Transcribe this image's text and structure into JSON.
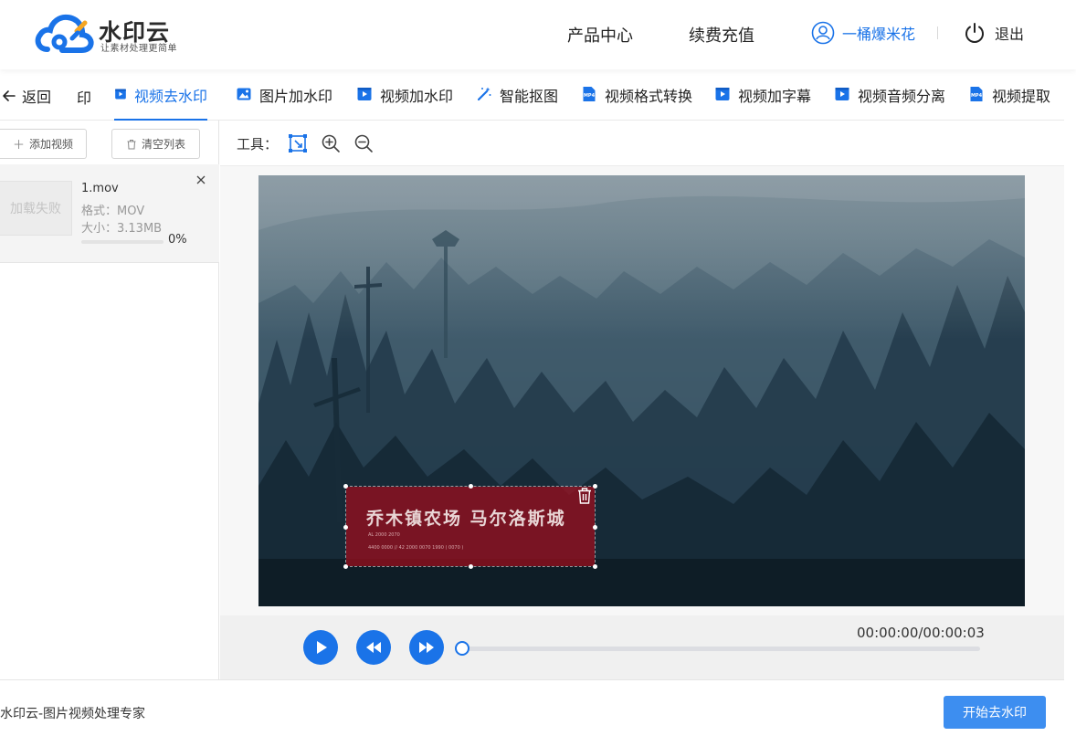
{
  "header": {
    "logo_name": "水印云",
    "logo_slogan": "让素材处理更简单",
    "nav": [
      "产品中心",
      "续费充值"
    ],
    "user_name": "一桶爆米花",
    "logout_label": "退出"
  },
  "toolnav": {
    "back_label": "返回",
    "cut_tab_label": "印",
    "tabs": [
      {
        "label": "视频去水印",
        "icon": "video-icon",
        "active": true
      },
      {
        "label": "图片加水印",
        "icon": "image-icon",
        "active": false
      },
      {
        "label": "视频加水印",
        "icon": "video-icon",
        "active": false
      },
      {
        "label": "智能抠图",
        "icon": "magic-wand-icon",
        "active": false
      },
      {
        "label": "视频格式转换",
        "icon": "mp4-icon",
        "active": false
      },
      {
        "label": "视频加字幕",
        "icon": "video-icon",
        "active": false
      },
      {
        "label": "视频音频分离",
        "icon": "video-icon",
        "active": false
      },
      {
        "label": "视频提取",
        "icon": "mp4-icon",
        "active": false
      }
    ]
  },
  "left_panel": {
    "add_label": "添加视频",
    "clear_label": "清空列表",
    "file": {
      "thumb_text": "加载失败",
      "name": "1.mov",
      "format": "格式：MOV",
      "size": "大小：3.13MB",
      "progress_text": "0%",
      "progress": 0
    }
  },
  "main": {
    "tools_label": "工具：",
    "tools": [
      "select-region-icon",
      "zoom-in-icon",
      "zoom-out-icon"
    ],
    "watermark_text": "乔木镇农场 马尔洛斯城",
    "watermark_line_1": "AL 2000 2070",
    "watermark_line_2": "4400 0000 // 42 2000 0070      1990    ( 0070 )",
    "time": "00:00:00/00:00:03",
    "playback_progress": 0
  },
  "footer": {
    "text": "水印云-图片视频处理专家",
    "start_label": "开始去水印"
  },
  "colors": {
    "accent": "#1a73e8",
    "button": "#3d8ef0",
    "watermark_box": "#a00c1c"
  }
}
